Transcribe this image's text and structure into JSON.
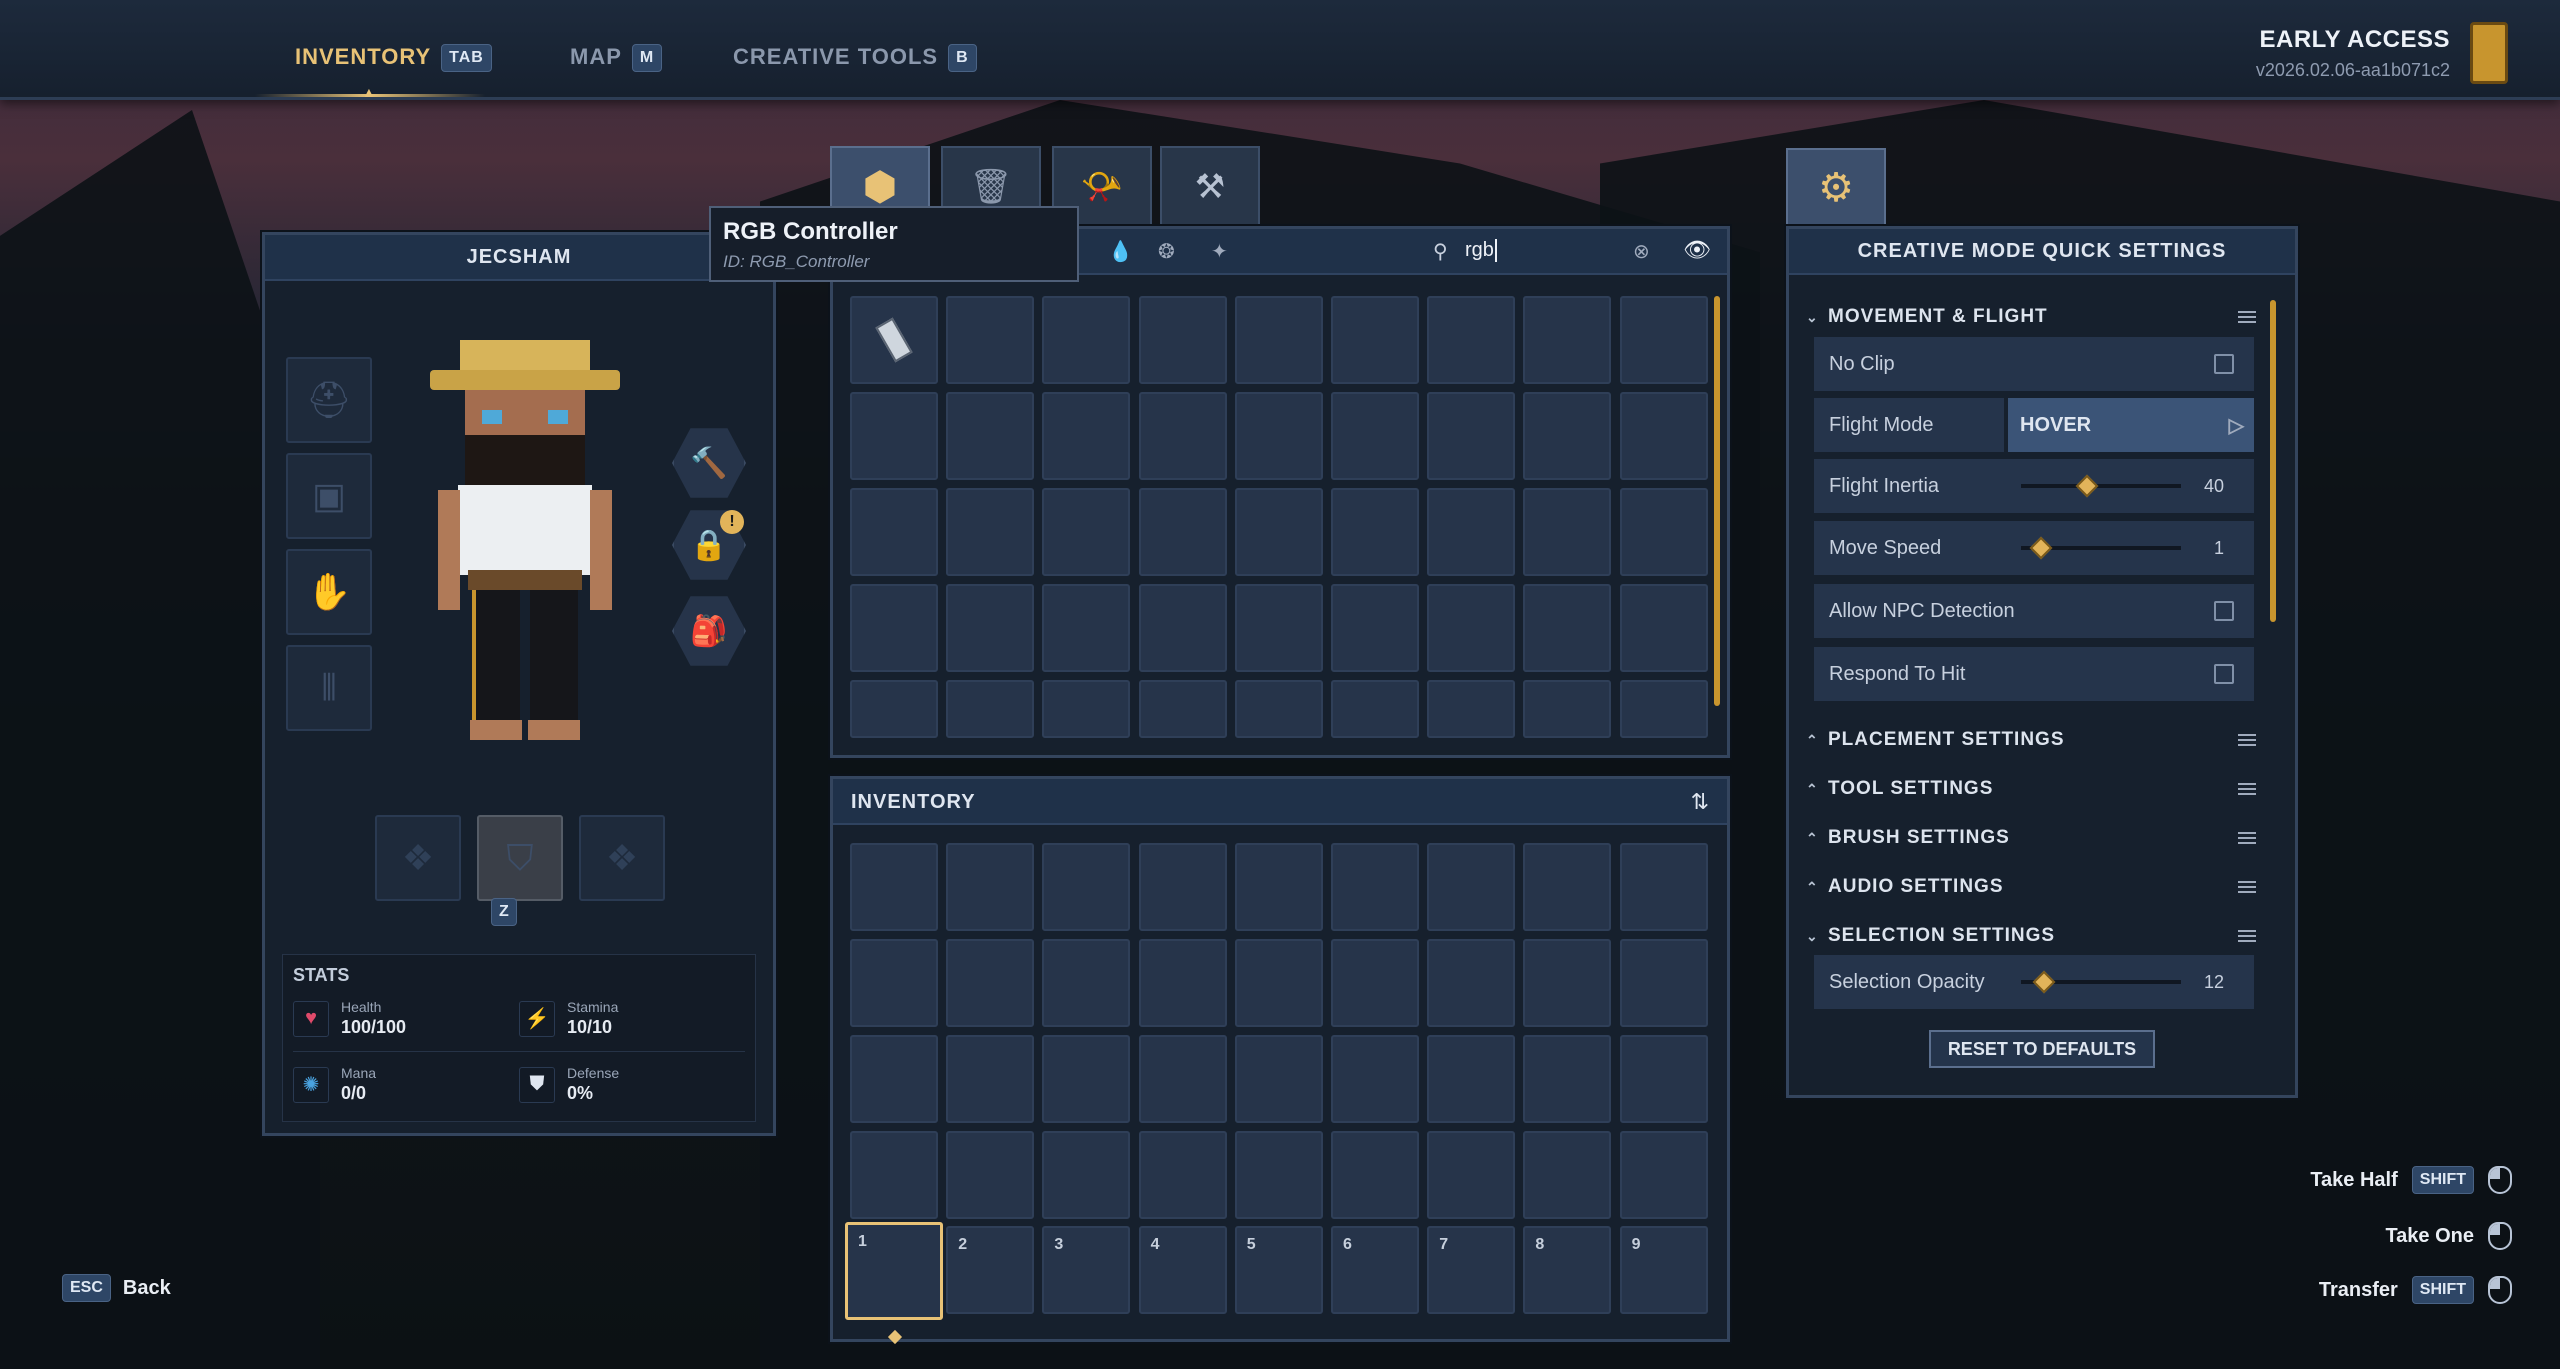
{
  "nav": {
    "tabs": [
      {
        "label": "INVENTORY",
        "key": "TAB"
      },
      {
        "label": "MAP",
        "key": "M"
      },
      {
        "label": "CREATIVE TOOLS",
        "key": "B"
      }
    ],
    "active_tab": "INVENTORY"
  },
  "build": {
    "title": "EARLY ACCESS",
    "version": "v2026.02.06-aa1b071c2"
  },
  "character": {
    "name": "JECSHAM",
    "weapon_key": "Z",
    "stats_title": "STATS",
    "stats": [
      {
        "name": "Health",
        "value": "100/100"
      },
      {
        "name": "Stamina",
        "value": "10/10"
      },
      {
        "name": "Mana",
        "value": "0/0"
      },
      {
        "name": "Defense",
        "value": "0%"
      }
    ]
  },
  "item_library": {
    "search_value": "rgb",
    "tooltip": {
      "title": "RGB Controller",
      "id": "ID: RGB_Controller"
    },
    "first_item": "rgb-controller-icon"
  },
  "inventory": {
    "title": "INVENTORY",
    "hotbar": [
      "1",
      "2",
      "3",
      "4",
      "5",
      "6",
      "7",
      "8",
      "9"
    ],
    "selected_slot": 1
  },
  "settings": {
    "title": "CREATIVE MODE QUICK SETTINGS",
    "movement_section": "MOVEMENT & FLIGHT",
    "rows": {
      "no_clip": "No Clip",
      "flight_mode": "Flight Mode",
      "flight_mode_value": "HOVER",
      "flight_inertia": "Flight Inertia",
      "flight_inertia_value": "40",
      "move_speed": "Move Speed",
      "move_speed_value": "1",
      "allow_npc": "Allow NPC Detection",
      "respond_hit": "Respond To Hit"
    },
    "sliders": {
      "flight_inertia": 0.38,
      "move_speed": 0.08,
      "selection_opacity": 0.1
    },
    "sections": [
      "PLACEMENT SETTINGS",
      "TOOL SETTINGS",
      "BRUSH SETTINGS",
      "AUDIO SETTINGS",
      "SELECTION SETTINGS"
    ],
    "selection_opacity": "Selection Opacity",
    "selection_opacity_value": "12",
    "reset_label": "RESET TO DEFAULTS"
  },
  "hints": {
    "take_half": "Take Half",
    "take_half_key": "SHIFT",
    "take_one": "Take One",
    "transfer": "Transfer",
    "transfer_key": "SHIFT",
    "back_key": "ESC",
    "back": "Back"
  },
  "colors": {
    "accent": "#e8c276",
    "panel": "#16202d",
    "slot": "#26344a"
  }
}
